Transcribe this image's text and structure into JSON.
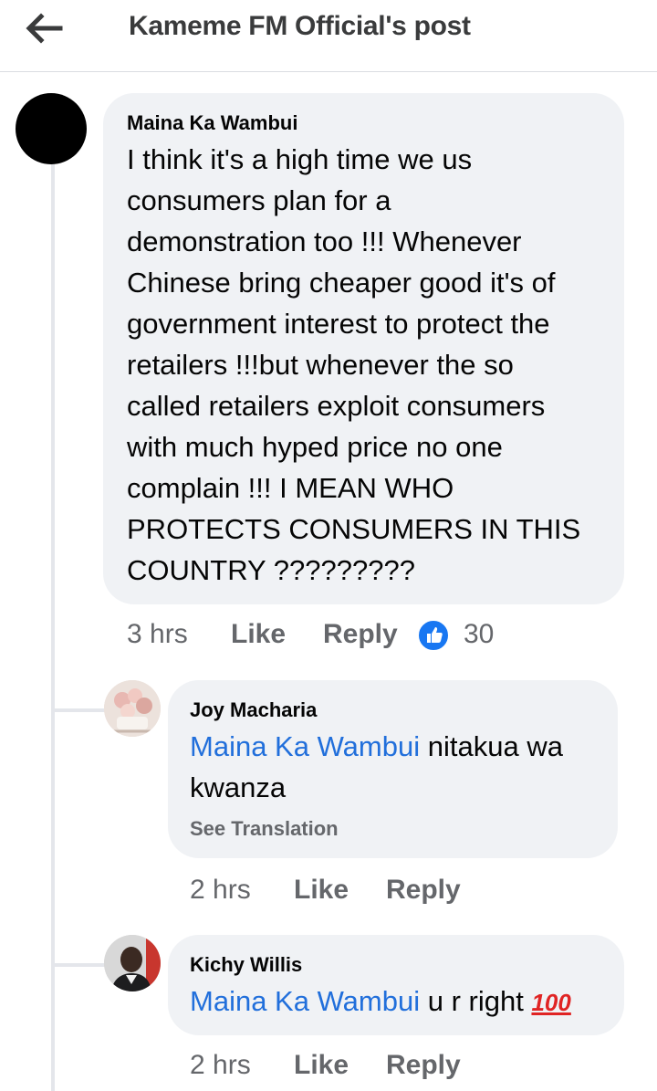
{
  "header": {
    "title": "Kameme FM Official's post"
  },
  "comments": [
    {
      "author": "Maina Ka Wambui",
      "text": "I think it's a high time we us consumers plan for a demonstration too !!!  Whenever Chinese bring cheaper good  it's of government interest to protect the retailers !!!but whenever the so called retailers exploit consumers with much hyped price no one complain !!! I MEAN WHO PROTECTS CONSUMERS IN THIS COUNTRY ?????????",
      "lines": [
        "I think it's a high time we us",
        "consumers plan for a",
        "demonstration too !!!  Whenever",
        "Chinese bring cheaper good  it's of",
        "government interest to protect the",
        "retailers !!!but whenever the so",
        "called retailers exploit consumers",
        "with much hyped price no one",
        "complain !!! I MEAN WHO",
        "PROTECTS CONSUMERS IN THIS",
        "COUNTRY ?????????"
      ],
      "time": "3 hrs",
      "like_label": "Like",
      "reply_label": "Reply",
      "reaction_count": "30",
      "reaction_icon": "thumbs-up-icon",
      "reaction_color": "#1877f2"
    },
    {
      "author": "Joy Macharia",
      "mention": "Maina Ka Wambui",
      "text_after_mention": " nitakua wa",
      "text_line2": "kwanza",
      "see_translation": "See Translation",
      "time": "2 hrs",
      "like_label": "Like",
      "reply_label": "Reply"
    },
    {
      "author": "Kichy Willis",
      "mention": "Maina Ka Wambui",
      "text_after_mention": " u r right ",
      "emoji": "100",
      "time": "2 hrs",
      "like_label": "Like",
      "reply_label": "Reply"
    }
  ],
  "colors": {
    "mention": "#216fdb",
    "bubble": "#f0f2f5",
    "meta": "#65676b"
  }
}
